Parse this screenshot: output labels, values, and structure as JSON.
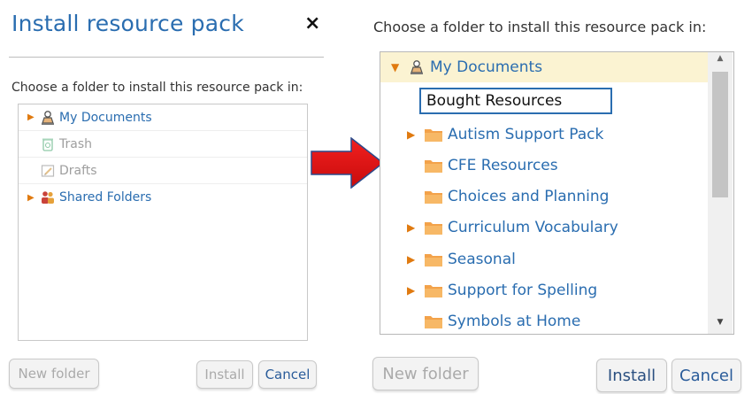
{
  "left_dialog": {
    "title": "Install resource pack",
    "close_label": "×",
    "prompt": "Choose a folder to install this resource pack in:",
    "tree": [
      {
        "label": "My Documents",
        "icon": "user-documents-icon",
        "expandable": true,
        "enabled": true
      },
      {
        "label": "Trash",
        "icon": "trash-icon",
        "expandable": false,
        "enabled": false
      },
      {
        "label": "Drafts",
        "icon": "drafts-icon",
        "expandable": false,
        "enabled": false
      },
      {
        "label": "Shared Folders",
        "icon": "shared-folders-icon",
        "expandable": true,
        "enabled": true
      }
    ],
    "buttons": {
      "new_folder": "New folder",
      "install": "Install",
      "cancel": "Cancel"
    }
  },
  "right_dialog": {
    "prompt": "Choose a folder to install this resource pack in:",
    "root": {
      "label": "My Documents",
      "expanded": true,
      "selected": true
    },
    "new_folder_value": "Bought Resources",
    "folders": [
      {
        "label": "Autism Support Pack",
        "expandable": true
      },
      {
        "label": "CFE Resources",
        "expandable": false
      },
      {
        "label": "Choices and Planning",
        "expandable": false
      },
      {
        "label": "Curriculum Vocabulary",
        "expandable": true
      },
      {
        "label": "Seasonal",
        "expandable": true
      },
      {
        "label": "Support for Spelling",
        "expandable": true
      },
      {
        "label": "Symbols at Home",
        "expandable": false
      }
    ],
    "buttons": {
      "new_folder": "New folder",
      "install": "Install",
      "cancel": "Cancel"
    }
  },
  "colors": {
    "accent": "#2a6db0",
    "folder": "#f3a24a",
    "arrow": "#e81818",
    "expander": "#e07a10"
  }
}
